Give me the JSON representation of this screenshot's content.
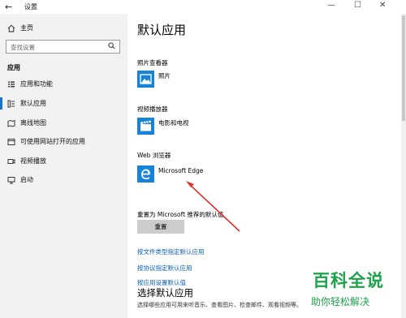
{
  "window": {
    "back_glyph": "←",
    "title": "设置",
    "minimize_glyph": "—",
    "maximize_glyph": "☐",
    "close_glyph": "✕"
  },
  "sidebar": {
    "home_label": "主页",
    "search_placeholder": "查找设置",
    "section_title": "应用",
    "items": [
      {
        "label": "应用和功能",
        "icon": "apps-list-icon"
      },
      {
        "label": "默认应用",
        "icon": "default-apps-icon",
        "active": true
      },
      {
        "label": "离线地图",
        "icon": "map-icon"
      },
      {
        "label": "可使用网站打开的应用",
        "icon": "web-apps-icon"
      },
      {
        "label": "视频播放",
        "icon": "video-icon"
      },
      {
        "label": "启动",
        "icon": "startup-icon"
      }
    ]
  },
  "main": {
    "title": "默认应用",
    "categories": [
      {
        "label": "照片查看器",
        "app": "照片",
        "icon": "photos-icon"
      },
      {
        "label": "视频播放器",
        "app": "电影和电视",
        "icon": "movies-tv-icon"
      },
      {
        "label": "Web 浏览器",
        "app": "Microsoft Edge",
        "icon": "edge-icon"
      }
    ],
    "reset_label": "重置为 Microsoft 推荐的默认值",
    "reset_button": "重置",
    "links": [
      "按文件类型指定默认应用",
      "按协议指定默认应用",
      "按应用设置默认值"
    ],
    "subtitle": "选择默认应用",
    "description": "选择哪些应用可用来听音乐、查看图片、检查邮件、观看视频等。"
  },
  "watermark": {
    "line1": "百科全说",
    "line2": "助你轻松解决"
  },
  "colors": {
    "accent": "#1683d8",
    "link": "#0b5fb3",
    "arrow": "#e0312f",
    "watermark": "#1aa34a"
  }
}
